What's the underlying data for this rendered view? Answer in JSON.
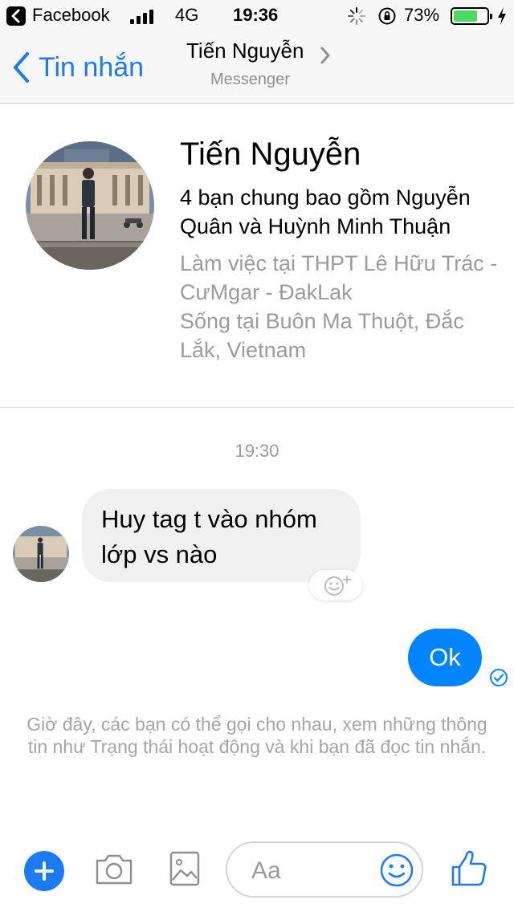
{
  "status_bar": {
    "app_name": "Facebook",
    "network": "4G",
    "time": "19:36",
    "battery_percent": "73%",
    "battery_level": 0.73,
    "battery_color": "#4cd964"
  },
  "nav": {
    "back_label": "Tin nhắn",
    "title": "Tiến Nguyễn",
    "subtitle": "Messenger",
    "accent_color": "#1a7bf2"
  },
  "profile": {
    "name": "Tiến Nguyễn",
    "mutual_friends": "4 bạn chung bao gồm Nguyễn Quân và Huỳnh Minh Thuận",
    "work": "Làm việc tại THPT Lê Hữu Trác - CưMgar - ĐakLak",
    "lives": "Sống tại Buôn Ma Thuột, Đắc Lắk, Vietnam"
  },
  "chat": {
    "timestamp": "19:30",
    "messages": [
      {
        "from": "them",
        "text": "Huy tag t vào nhóm lớp vs nào"
      },
      {
        "from": "me",
        "text": "Ok"
      }
    ],
    "notice": "Giờ đây, các bạn có thể gọi cho nhau, xem những thông tin như Trạng thái hoạt động và khi bạn đã đọc tin nhắn.",
    "bubble_out_color": "#0084ff"
  },
  "composer": {
    "placeholder": "Aa",
    "icons": [
      "plus-icon",
      "camera-icon",
      "gallery-icon",
      "emoji-icon",
      "thumbs-up-icon"
    ]
  }
}
